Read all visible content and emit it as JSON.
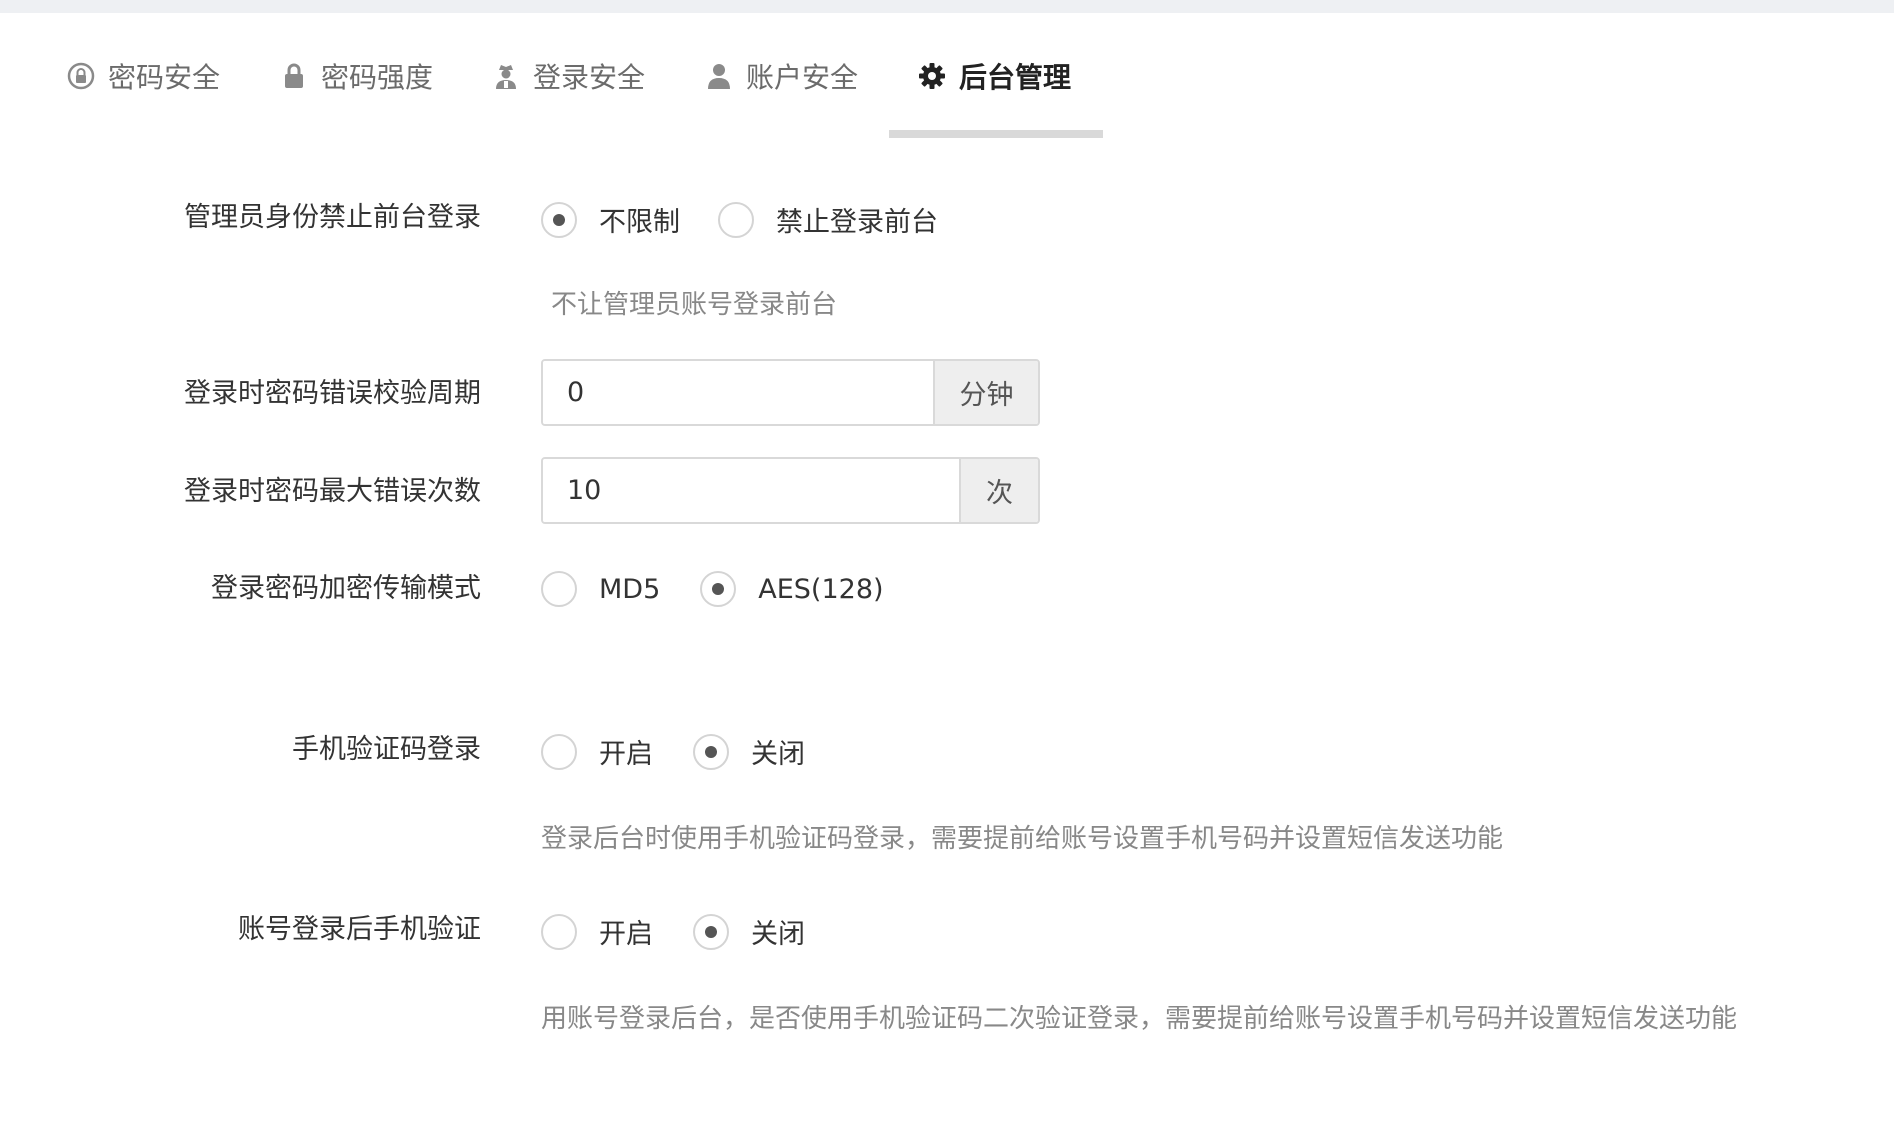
{
  "tabs": [
    {
      "label": "密码安全",
      "icon": "lock-circle-icon",
      "active": false
    },
    {
      "label": "密码强度",
      "icon": "padlock-icon",
      "active": false
    },
    {
      "label": "登录安全",
      "icon": "user-secret-icon",
      "active": false
    },
    {
      "label": "账户安全",
      "icon": "user-icon",
      "active": false
    },
    {
      "label": "后台管理",
      "icon": "gear-icon",
      "active": true
    }
  ],
  "form": {
    "admin_frontend": {
      "label": "管理员身份禁止前台登录",
      "options": [
        "不限制",
        "禁止登录前台"
      ],
      "selected": 0,
      "help": "不让管理员账号登录前台"
    },
    "error_period": {
      "label": "登录时密码错误校验周期",
      "value": "0",
      "unit": "分钟"
    },
    "max_errors": {
      "label": "登录时密码最大错误次数",
      "value": "10",
      "unit": "次"
    },
    "encrypt_mode": {
      "label": "登录密码加密传输模式",
      "options": [
        "MD5",
        "AES(128)"
      ],
      "selected": 1
    },
    "sms_login": {
      "label": "手机验证码登录",
      "options": [
        "开启",
        "关闭"
      ],
      "selected": 1,
      "help": "登录后台时使用手机验证码登录，需要提前给账号设置手机号码并设置短信发送功能"
    },
    "sms_verify": {
      "label": "账号登录后手机验证",
      "options": [
        "开启",
        "关闭"
      ],
      "selected": 1,
      "help": "用账号登录后台，是否使用手机验证码二次验证登录，需要提前给账号设置手机号码并设置短信发送功能"
    }
  }
}
